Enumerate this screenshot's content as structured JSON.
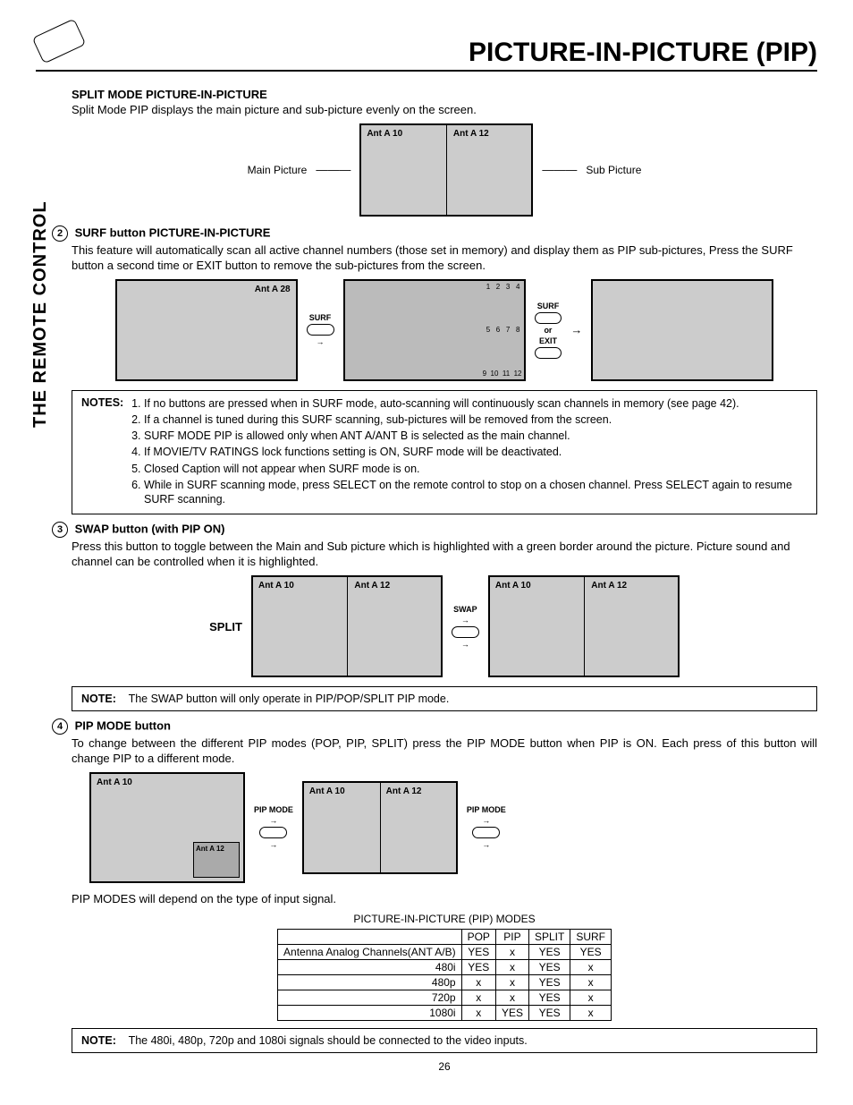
{
  "header": {
    "title": "PICTURE-IN-PICTURE (PIP)"
  },
  "sidebar": "THE REMOTE CONTROL",
  "section1": {
    "heading": "SPLIT MODE PICTURE-IN-PICTURE",
    "body": "Split Mode PIP displays the main picture and sub-picture evenly on the screen.",
    "main_label": "Main Picture",
    "sub_label": "Sub Picture",
    "ant_a10": "Ant A 10",
    "ant_a12": "Ant A 12"
  },
  "section2": {
    "num": "2",
    "heading": "SURF button PICTURE-IN-PICTURE",
    "body": "This feature will automatically scan all active channel numbers (those set in memory) and display them as PIP sub-pictures,   Press the SURF button a second time or EXIT button to remove the sub-pictures from the screen.",
    "ant_a28": "Ant A   28",
    "surf": "SURF",
    "exit": "EXIT",
    "or": "or",
    "grid_nums": [
      "1",
      "2",
      "3",
      "4",
      "5",
      "6",
      "7",
      "8",
      "9",
      "10",
      "11",
      "12"
    ]
  },
  "notes1": {
    "label": "NOTES:",
    "items": [
      "If no buttons are pressed when in SURF mode, auto-scanning will continuously scan channels in memory (see page 42).",
      "If a channel is tuned during this SURF scanning, sub-pictures will be removed from the screen.",
      "SURF MODE PIP is allowed only when ANT A/ANT B is selected as the main channel.",
      "If MOVIE/TV RATINGS lock functions setting is ON, SURF mode will be deactivated.",
      "Closed Caption will not appear when SURF mode is on.",
      "While in SURF scanning mode, press SELECT on the remote control to stop on a chosen channel. Press SELECT again to resume SURF scanning."
    ]
  },
  "section3": {
    "num": "3",
    "heading": "SWAP button (with PIP ON)",
    "body": "Press this button to toggle between the Main and Sub picture which is highlighted with a green border around the picture.  Picture sound and channel can be controlled when it is highlighted.",
    "split": "SPLIT",
    "swap": "SWAP",
    "ant_a10": "Ant A 10",
    "ant_a12": "Ant A 12"
  },
  "note2": {
    "label": "NOTE:",
    "body": "The SWAP button will only operate in PIP/POP/SPLIT PIP mode."
  },
  "section4": {
    "num": "4",
    "heading": "PIP MODE button",
    "body": "To change between the different PIP modes (POP, PIP, SPLIT) press the PIP MODE button when PIP is ON.  Each press of this button will change PIP to a different mode.",
    "pip_mode": "PIP MODE",
    "ant_a10": "Ant A 10",
    "ant_a12": "Ant A 12",
    "footer": "PIP MODES will depend on the type of input signal."
  },
  "table": {
    "title": "PICTURE-IN-PICTURE (PIP) MODES",
    "headers": [
      "",
      "POP",
      "PIP",
      "SPLIT",
      "SURF"
    ],
    "rows": [
      [
        "Antenna Analog Channels(ANT A/B)",
        "YES",
        "x",
        "YES",
        "YES"
      ],
      [
        "480i",
        "YES",
        "x",
        "YES",
        "x"
      ],
      [
        "480p",
        "x",
        "x",
        "YES",
        "x"
      ],
      [
        "720p",
        "x",
        "x",
        "YES",
        "x"
      ],
      [
        "1080i",
        "x",
        "YES",
        "YES",
        "x"
      ]
    ]
  },
  "note3": {
    "label": "NOTE:",
    "body": "The 480i, 480p, 720p and 1080i signals should be connected to the video inputs."
  },
  "page_number": "26"
}
